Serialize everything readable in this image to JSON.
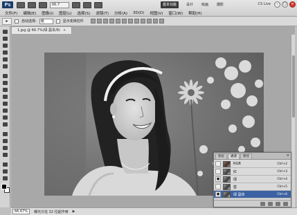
{
  "app": {
    "logo_text": "Ps"
  },
  "toolbar": {
    "zoom_value": "66.7",
    "workspaces": [
      {
        "label": "基本功能",
        "active": true
      },
      {
        "label": "设计",
        "active": false
      },
      {
        "label": "绘画",
        "active": false
      },
      {
        "label": "摄影",
        "active": false
      }
    ],
    "cs_live": "CS Live",
    "window_controls": [
      "minimize",
      "maximize",
      "close"
    ]
  },
  "menu": {
    "items": [
      "文件(F)",
      "编辑(E)",
      "图像(I)",
      "图层(L)",
      "选择(S)",
      "滤镜(T)",
      "分析(A)",
      "3D(D)",
      "视图(V)",
      "窗口(W)",
      "帮助(H)"
    ]
  },
  "options": {
    "auto_select_label": "自动选择:",
    "auto_select_value": "组",
    "show_transform_label": "显示变换控件"
  },
  "document": {
    "tab_title": "1.jpg @ 66.7%(绿 副本/8)",
    "tab_close": "×"
  },
  "status": {
    "zoom": "66.67%",
    "text": "曝光只在 32 位起作用",
    "arrow": "▶"
  },
  "channels_panel": {
    "tabs": [
      {
        "label": "图层",
        "active": false
      },
      {
        "label": "通道",
        "active": true
      },
      {
        "label": "路径",
        "active": false
      }
    ],
    "menu_icon": "≡",
    "rows": [
      {
        "name": "RGB",
        "shortcut": "Ctrl+2",
        "visible": false,
        "selected": false,
        "thumb": "color"
      },
      {
        "name": "红",
        "shortcut": "Ctrl+3",
        "visible": false,
        "selected": false,
        "thumb": "gray"
      },
      {
        "name": "绿",
        "shortcut": "Ctrl+4",
        "visible": true,
        "selected": false,
        "thumb": "gray"
      },
      {
        "name": "蓝",
        "shortcut": "Ctrl+5",
        "visible": false,
        "selected": false,
        "thumb": "gray"
      },
      {
        "name": "绿 副本",
        "shortcut": "Ctrl+6",
        "visible": true,
        "selected": true,
        "thumb": "gray"
      }
    ]
  },
  "colors": {
    "foreground": "#000000",
    "background": "#ffffff",
    "selected_row": "#3c62a3",
    "active_workspace": "#3a3a3a"
  }
}
